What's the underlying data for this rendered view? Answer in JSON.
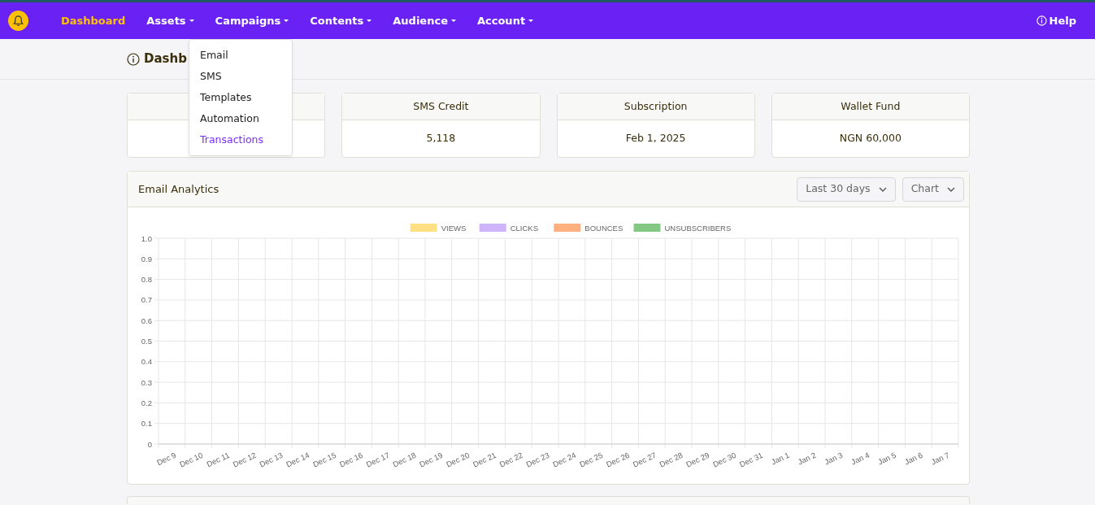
{
  "navbar": {
    "items": [
      {
        "label": "Dashboard",
        "selected": true,
        "dropdown": false
      },
      {
        "label": "Assets",
        "selected": false,
        "dropdown": true
      },
      {
        "label": "Campaigns",
        "selected": false,
        "dropdown": true
      },
      {
        "label": "Contents",
        "selected": false,
        "dropdown": true
      },
      {
        "label": "Audience",
        "selected": false,
        "dropdown": true
      },
      {
        "label": "Account",
        "selected": false,
        "dropdown": true
      }
    ],
    "help": "Help"
  },
  "dropdown_menu": {
    "items": [
      {
        "label": "Email",
        "selected": false
      },
      {
        "label": "SMS",
        "selected": false
      },
      {
        "label": "Templates",
        "selected": false
      },
      {
        "label": "Automation",
        "selected": false
      },
      {
        "label": "Transactions",
        "selected": true
      }
    ]
  },
  "page_title": "Dashb",
  "stats": [
    {
      "blank": true
    },
    {
      "title": "SMS Credit",
      "value": "5,118"
    },
    {
      "title": "Subscription",
      "value": "Feb 1, 2025"
    },
    {
      "title": "Wallet Fund",
      "value": "NGN 60,000"
    }
  ],
  "analytics": {
    "title": "Email Analytics",
    "period": "Last 30 days",
    "view": "Chart",
    "chart_data": {
      "type": "bar",
      "categories": [
        "Dec 9",
        "Dec 10",
        "Dec 11",
        "Dec 12",
        "Dec 13",
        "Dec 14",
        "Dec 15",
        "Dec 16",
        "Dec 17",
        "Dec 18",
        "Dec 19",
        "Dec 20",
        "Dec 21",
        "Dec 22",
        "Dec 23",
        "Dec 24",
        "Dec 25",
        "Dec 26",
        "Dec 27",
        "Dec 28",
        "Dec 29",
        "Dec 30",
        "Dec 31",
        "Jan 1",
        "Jan 2",
        "Jan 3",
        "Jan 4",
        "Jan 5",
        "Jan 6",
        "Jan 7"
      ],
      "series": [
        {
          "name": "VIEWS",
          "color": "#ffe083",
          "values": [
            0,
            0,
            0,
            0,
            0,
            0,
            0,
            0,
            0,
            0,
            0,
            0,
            0,
            0,
            0,
            0,
            0,
            0,
            0,
            0,
            0,
            0,
            0,
            0,
            0,
            0,
            0,
            0,
            0,
            0
          ]
        },
        {
          "name": "CLICKS",
          "color": "#cfb3fb",
          "values": [
            0,
            0,
            0,
            0,
            0,
            0,
            0,
            0,
            0,
            0,
            0,
            0,
            0,
            0,
            0,
            0,
            0,
            0,
            0,
            0,
            0,
            0,
            0,
            0,
            0,
            0,
            0,
            0,
            0,
            0
          ]
        },
        {
          "name": "BOUNCES",
          "color": "#ffb07f",
          "values": [
            0,
            0,
            0,
            0,
            0,
            0,
            0,
            0,
            0,
            0,
            0,
            0,
            0,
            0,
            0,
            0,
            0,
            0,
            0,
            0,
            0,
            0,
            0,
            0,
            0,
            0,
            0,
            0,
            0,
            0
          ]
        },
        {
          "name": "UNSUBSCRIBERS",
          "color": "#84c983",
          "values": [
            0,
            0,
            0,
            0,
            0,
            0,
            0,
            0,
            0,
            0,
            0,
            0,
            0,
            0,
            0,
            0,
            0,
            0,
            0,
            0,
            0,
            0,
            0,
            0,
            0,
            0,
            0,
            0,
            0,
            0
          ]
        }
      ],
      "grid": true,
      "ylim": [
        0,
        1
      ],
      "yticks": [
        {
          "value": 0,
          "label": "0"
        },
        {
          "value": 0.1,
          "label": "0.1"
        },
        {
          "value": 0.2,
          "label": "0.2"
        },
        {
          "value": 0.3,
          "label": "0.3"
        },
        {
          "value": 0.4,
          "label": "0.4"
        },
        {
          "value": 0.5,
          "label": "0.5"
        },
        {
          "value": 0.6,
          "label": "0.6"
        },
        {
          "value": 0.7,
          "label": "0.7"
        },
        {
          "value": 0.8,
          "label": "0.8"
        },
        {
          "value": 0.9,
          "label": "0.9"
        },
        {
          "value": 1,
          "label": "1.0"
        }
      ]
    }
  }
}
